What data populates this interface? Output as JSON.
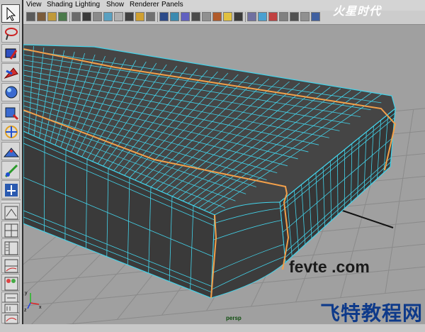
{
  "menubar": {
    "items": [
      "View",
      "Shading",
      "Lighting",
      "Show",
      "Renderer",
      "Panels"
    ]
  },
  "viewport": {
    "camera_label": "persp"
  },
  "watermarks": {
    "logo_text": "火星时代",
    "domain_text": "fevte .com",
    "brand_text": "飞特教程网"
  },
  "colors": {
    "viewport_bg": "#a0a0a0",
    "grid_line": "#8a8a8a",
    "mesh_face": "#3e3e3e",
    "mesh_edge": "#43d3ea",
    "selected_edge": "#f3a04a",
    "panel_bg": "#c8c8c8"
  },
  "toolbox": {
    "tools": [
      {
        "name": "select-tool",
        "icon": "arrow-icon"
      },
      {
        "name": "lasso-tool",
        "icon": "lasso-icon"
      },
      {
        "name": "paint-select-tool",
        "icon": "paint-brush-icon"
      },
      {
        "name": "move-tool",
        "icon": "move-icon"
      },
      {
        "name": "rotate-tool",
        "icon": "rotate-icon"
      },
      {
        "name": "scale-tool",
        "icon": "scale-icon"
      },
      {
        "name": "universal-manipulator",
        "icon": "manipulator-icon"
      },
      {
        "name": "soft-mod-tool",
        "icon": "soft-mod-icon"
      },
      {
        "name": "show-manipulator-tool",
        "icon": "show-manip-icon"
      },
      {
        "name": "last-tool-used",
        "icon": "last-tool-icon"
      }
    ],
    "layouts": [
      {
        "name": "single-perspective-layout",
        "icon": "single-pane-icon"
      },
      {
        "name": "four-view-layout",
        "icon": "four-pane-icon"
      },
      {
        "name": "persp-outliner-layout",
        "icon": "persp-outliner-icon"
      },
      {
        "name": "persp-graph-layout",
        "icon": "persp-graph-icon"
      },
      {
        "name": "hypershade-persp-layout",
        "icon": "hypershade-icon"
      },
      {
        "name": "persp-hypergraph-layout",
        "icon": "hypergraph-icon"
      },
      {
        "name": "outliner-layout",
        "icon": "outliner-icon"
      },
      {
        "name": "graph-editor-layout",
        "icon": "graph-editor-icon"
      }
    ]
  },
  "panel_icons": [
    "select-camera-icon",
    "camera-attributes-icon",
    "bookmark-icon",
    "image-plane-icon",
    "two-d-pan-icon",
    "grid-icon",
    "film-gate-icon",
    "resolution-gate-icon",
    "gate-mask-icon",
    "field-chart-icon",
    "safe-action-icon",
    "safe-title-icon",
    "wireframe-icon",
    "smooth-shade-icon",
    "wireframe-on-shaded-icon",
    "flat-shade-icon",
    "bounding-box-icon",
    "textured-icon",
    "use-default-lights-icon",
    "shadows-icon",
    "high-quality-icon",
    "xray-icon",
    "xray-joints-icon",
    "isolate-select-icon",
    "grease-pencil-icon",
    "resolution-icon",
    "viewport-options-icon"
  ]
}
